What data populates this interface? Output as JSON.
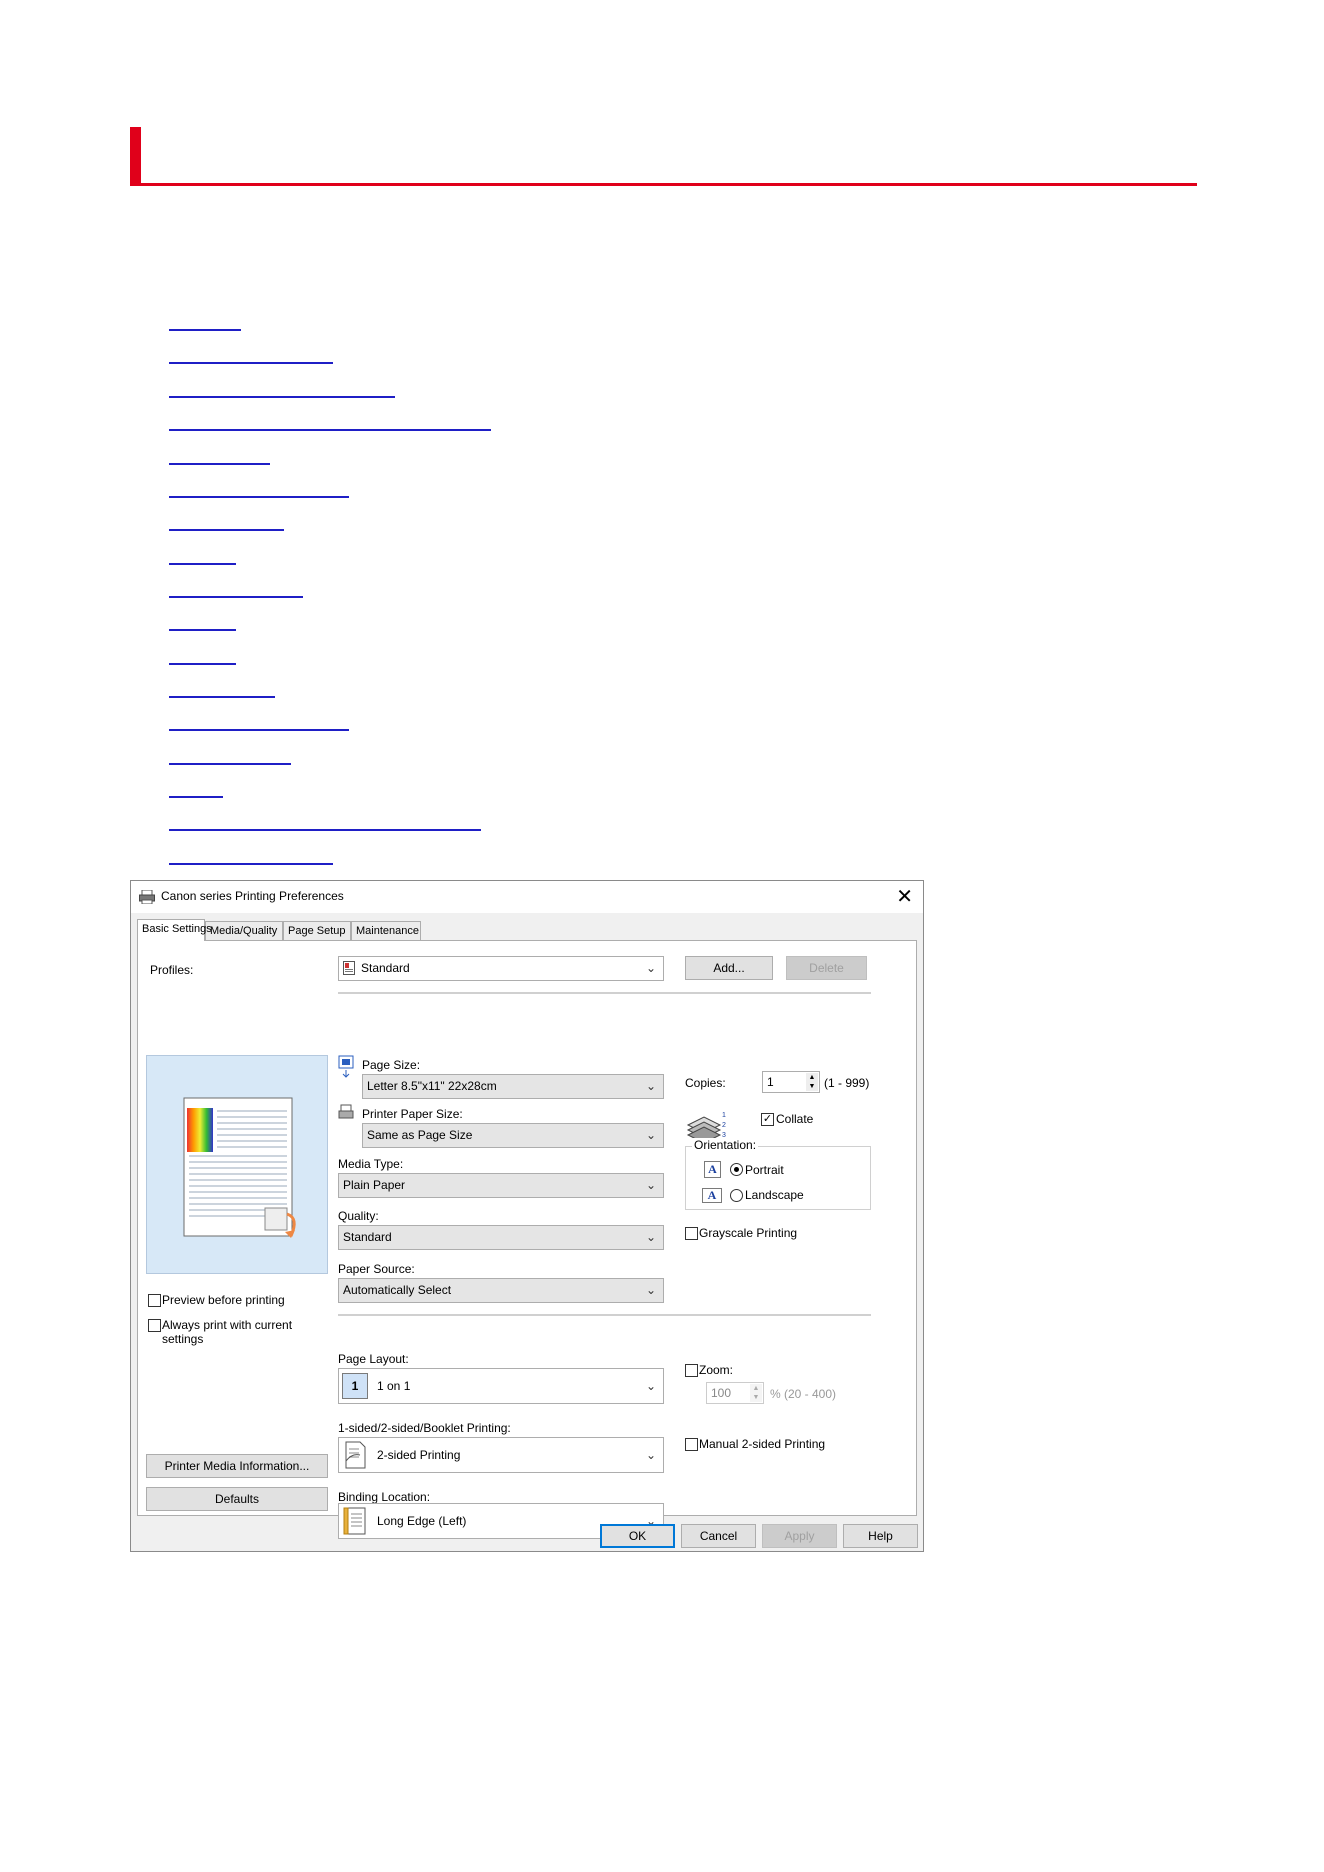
{
  "page": {
    "heading": "",
    "link_count": 17
  },
  "dialog": {
    "title": "Canon        series Printing Preferences",
    "close": "✕",
    "tabs": [
      "Basic Settings",
      "Media/Quality",
      "Page Setup",
      "Maintenance"
    ],
    "profiles_label": "Profiles:",
    "profile_value": "Standard",
    "add_button": "Add...",
    "delete_button": "Delete",
    "page_size_label": "Page Size:",
    "page_size_value": "Letter 8.5\"x11\" 22x28cm",
    "printer_paper_size_label": "Printer Paper Size:",
    "printer_paper_size_value": "Same as Page Size",
    "media_type_label": "Media Type:",
    "media_type_value": "Plain Paper",
    "quality_label": "Quality:",
    "quality_value": "Standard",
    "paper_source_label": "Paper Source:",
    "paper_source_value": "Automatically Select",
    "copies_label": "Copies:",
    "copies_value": "1",
    "copies_range": "(1 - 999)",
    "collate_label": "Collate",
    "orientation_label": "Orientation:",
    "portrait_label": "Portrait",
    "landscape_label": "Landscape",
    "grayscale_label": "Grayscale Printing",
    "preview_before_label": "Preview before printing",
    "always_print_label_1": "Always print with current",
    "always_print_label_2": "settings",
    "page_layout_label": "Page Layout:",
    "page_layout_value": "1 on 1",
    "page_layout_icon": "1",
    "zoom_label": "Zoom:",
    "zoom_value": "100",
    "zoom_range": "% (20 - 400)",
    "sided_label": "1-sided/2-sided/Booklet Printing:",
    "sided_value": "2-sided Printing",
    "manual_2sided_label": "Manual 2-sided Printing",
    "binding_label": "Binding Location:",
    "binding_value": "Long Edge (Left)",
    "printer_media_info_button": "Printer Media Information...",
    "defaults_button": "Defaults",
    "ok_button": "OK",
    "cancel_button": "Cancel",
    "apply_button": "Apply",
    "help_button": "Help"
  },
  "colors": {
    "accent_red": "#e0001a",
    "link_blue": "#1f1fc6",
    "preview_bg": "#d7e8f7",
    "focus_blue": "#0078d7"
  }
}
